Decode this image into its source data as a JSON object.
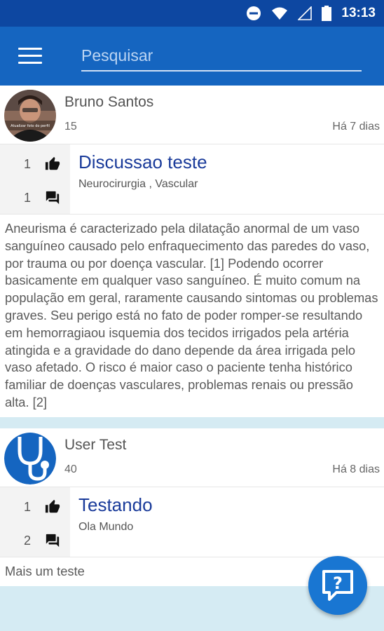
{
  "status_bar": {
    "time": "13:13",
    "icons": [
      "do-not-disturb-icon",
      "wifi-icon",
      "signal-icon",
      "battery-icon"
    ]
  },
  "app_bar": {
    "menu_icon": "menu-icon",
    "search_placeholder": "Pesquisar"
  },
  "posts": [
    {
      "author": "Bruno Santos",
      "score": "15",
      "date": "Há 7 dias",
      "avatar_caption": "Atualizar foto do perfil",
      "likes": "1",
      "comments": "1",
      "title": "Discussao teste",
      "tags": "Neurocirurgia , Vascular",
      "body": "Aneurisma é caracterizado pela dilatação anormal de um vaso sanguíneo causado pelo enfraquecimento das paredes do vaso, por trauma ou por doença vascular. [1] Podendo ocorrer basicamente em qualquer vaso sanguíneo. É muito comum na população em geral, raramente causando sintomas ou problemas graves. Seu perigo está no fato de poder romper-se resultando em hemorragiaou isquemia dos tecidos irrigados pela artéria atingida e a gravidade do dano depende da área irrigada pelo vaso afetado. O risco é maior caso o paciente tenha histórico familiar de doenças vasculares, problemas renais ou pressão alta. [2]"
    },
    {
      "author": "User Test",
      "score": "40",
      "date": "Há 8 dias",
      "likes": "1",
      "comments": "2",
      "title": "Testando",
      "tags": "Ola Mundo",
      "body": "Mais um teste"
    }
  ],
  "fab": {
    "icon": "help-chat-icon"
  },
  "colors": {
    "status_bar": "#0d47a1",
    "app_bar": "#1565c0",
    "title_link": "#1a3b9a",
    "fab": "#1976d2",
    "feed_background": "#d5ebf3"
  }
}
